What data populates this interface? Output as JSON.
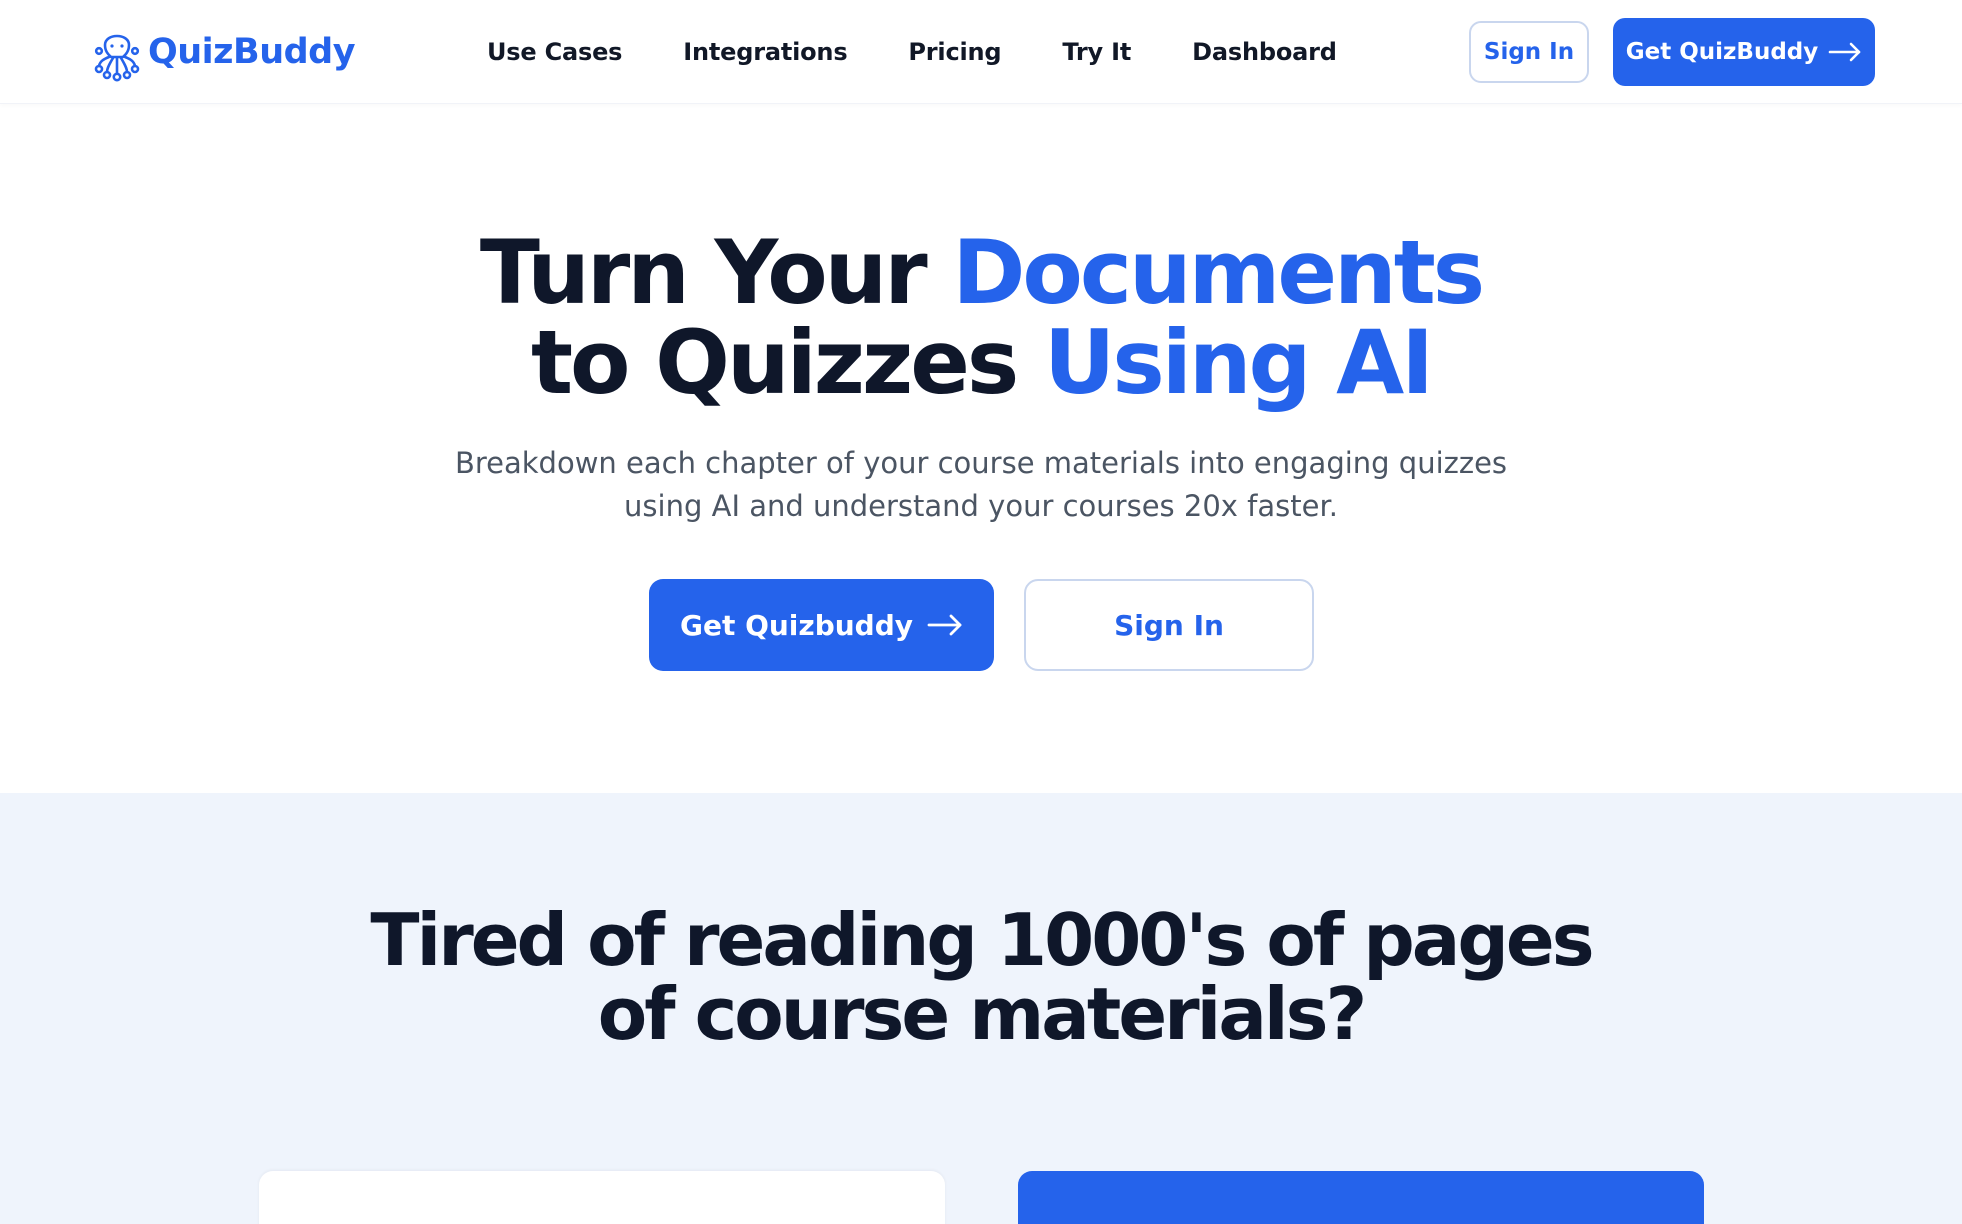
{
  "brand": {
    "name": "QuizBuddy",
    "icon": "octopus-logo-icon",
    "color": "#2563eb"
  },
  "nav": {
    "links": [
      "Use Cases",
      "Integrations",
      "Pricing",
      "Try It",
      "Dashboard"
    ],
    "sign_in_label": "Sign In",
    "cta_label": "Get QuizBuddy",
    "cta_icon": "arrow-right-icon"
  },
  "hero": {
    "title_line1_plain": "Turn Your ",
    "title_line1_accent": "Documents",
    "title_line2_plain": "to Quizzes ",
    "title_line2_accent": "Using AI",
    "subtitle_line1": "Breakdown each chapter of your course materials into engaging quizzes",
    "subtitle_line2": "using AI and understand your courses 20x faster.",
    "cta_label": "Get Quizbuddy",
    "cta_icon": "arrow-right-icon",
    "sign_in_label": "Sign In"
  },
  "problem": {
    "title_line1": "Tired of reading 1000's of pages",
    "title_line2": "of course materials?"
  },
  "colors": {
    "accent": "#2563eb",
    "heading": "#0f172a",
    "body": "#4b5563",
    "section_bg": "#eff4fc",
    "outline_border": "#c9d6ee"
  }
}
